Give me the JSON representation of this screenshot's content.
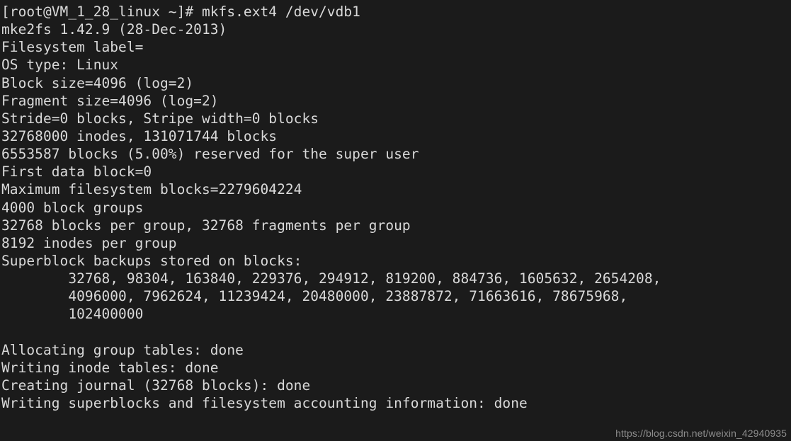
{
  "terminal": {
    "type": "shell-session",
    "background_color": "#1b1b1b",
    "text_color": "#d9d9d9",
    "prompt": "[root@VM_1_28_linux ~]#",
    "command": "mkfs.ext4 /dev/vdb1",
    "hostname": "VM_1_28_linux",
    "user": "root",
    "cwd": "~",
    "lines": [
      "[root@VM_1_28_linux ~]# mkfs.ext4 /dev/vdb1",
      "mke2fs 1.42.9 (28-Dec-2013)",
      "Filesystem label=",
      "OS type: Linux",
      "Block size=4096 (log=2)",
      "Fragment size=4096 (log=2)",
      "Stride=0 blocks, Stripe width=0 blocks",
      "32768000 inodes, 131071744 blocks",
      "6553587 blocks (5.00%) reserved for the super user",
      "First data block=0",
      "Maximum filesystem blocks=2279604224",
      "4000 block groups",
      "32768 blocks per group, 32768 fragments per group",
      "8192 inodes per group",
      "Superblock backups stored on blocks:",
      "        32768, 98304, 163840, 229376, 294912, 819200, 884736, 1605632, 2654208,",
      "        4096000, 7962624, 11239424, 20480000, 23887872, 71663616, 78675968,",
      "        102400000",
      "",
      "Allocating group tables: done",
      "Writing inode tables: done",
      "Creating journal (32768 blocks): done",
      "Writing superblocks and filesystem accounting information: done"
    ]
  },
  "watermark": {
    "text": "https://blog.csdn.net/weixin_42940935"
  }
}
